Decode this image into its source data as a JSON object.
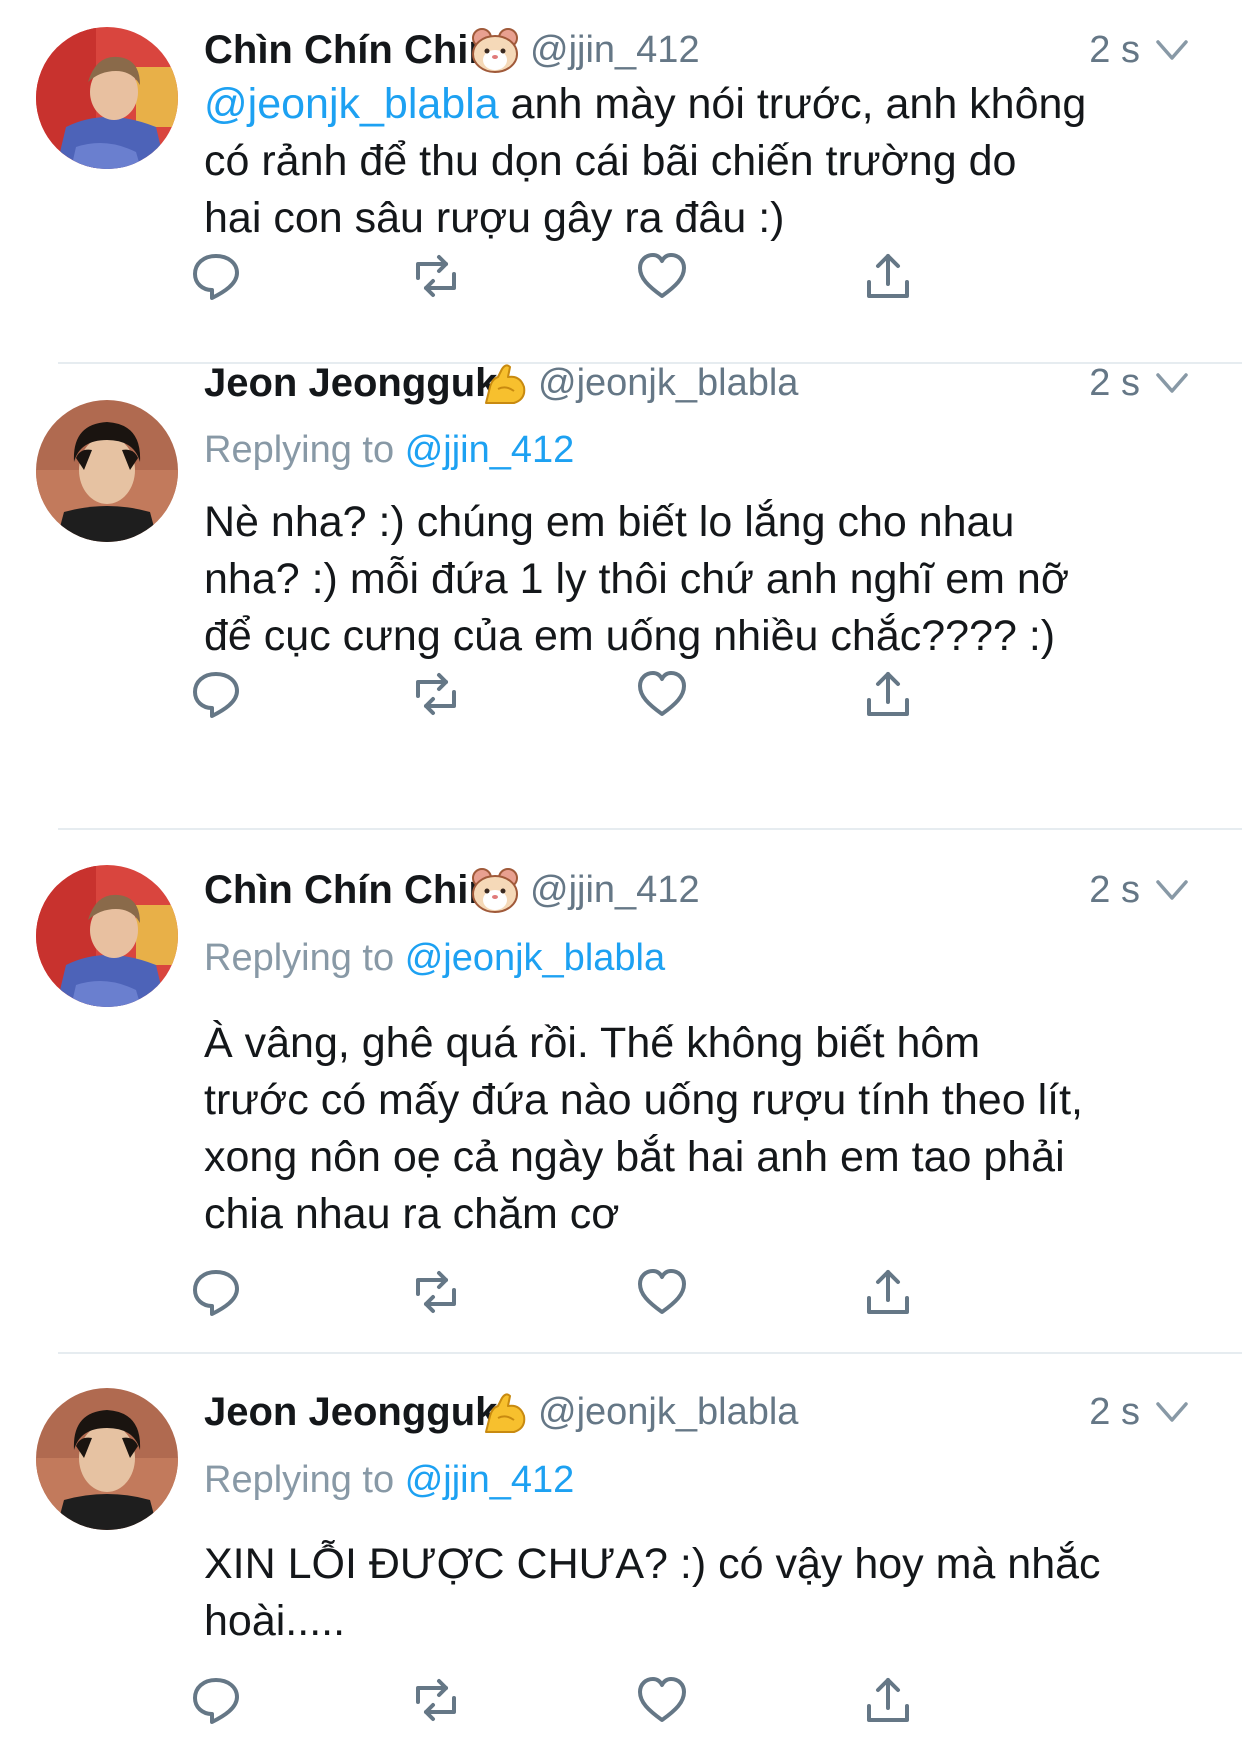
{
  "tweets": [
    {
      "name": "Chìn Chín Chin",
      "emoji": "hamster-face-emoji",
      "handle": "@jjin_412",
      "time": "2 s",
      "replying_prefix": "",
      "replying_to": "",
      "mention": "@jeonjk_blabla",
      "text_lines": [
        "anh mày nói trước, anh không",
        "có rảnh để thu dọn cái bãi chiến trường do",
        "hai con sâu rượu gây ra đâu :)"
      ]
    },
    {
      "name": "Jeon Jeongguk",
      "emoji": "flexed-biceps-emoji",
      "handle": "@jeonjk_blabla",
      "time": "2 s",
      "replying_prefix": "Replying to",
      "replying_to": "@jjin_412",
      "mention": "",
      "text_lines": [
        "Nè nha? :) chúng em biết lo lắng cho nhau",
        "nha? :) mỗi đứa 1 ly thôi chứ anh nghĩ em nỡ",
        "để cục cưng của em uống nhiều chắc???? :)"
      ]
    },
    {
      "name": "Chìn Chín Chin",
      "emoji": "hamster-face-emoji",
      "handle": "@jjin_412",
      "time": "2 s",
      "replying_prefix": "Replying to",
      "replying_to": "@jeonjk_blabla",
      "mention": "",
      "text_lines": [
        "À vâng, ghê quá rồi. Thế không biết hôm",
        "trước có mấy đứa nào uống rượu tính theo lít,",
        "xong nôn oẹ cả ngày bắt hai anh em tao phải",
        "chia nhau ra chăm cơ"
      ]
    },
    {
      "name": "Jeon Jeongguk",
      "emoji": "flexed-biceps-emoji",
      "handle": "@jeonjk_blabla",
      "time": "2 s",
      "replying_prefix": "Replying to",
      "replying_to": "@jjin_412",
      "mention": "",
      "text_lines": [
        "XIN LỖI ĐƯỢC CHƯA? :) có vậy hoy mà nhắc",
        "hoài....."
      ]
    }
  ],
  "colors": {
    "link": "#1da1f2",
    "secondary": "#657786",
    "replying": "#8899a6",
    "divider": "#e6ecf0"
  }
}
